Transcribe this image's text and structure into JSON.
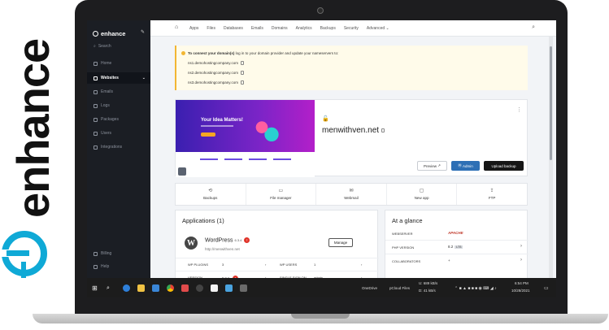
{
  "brand": {
    "wordmark": "enhance",
    "color": "#0fa9d6"
  },
  "sidebar": {
    "logo": "enhance",
    "search": "Search",
    "items": [
      {
        "label": "Home",
        "icon": "home-icon"
      },
      {
        "label": "Websites",
        "icon": "globe-icon",
        "active": true
      },
      {
        "label": "Emails",
        "icon": "mail-icon"
      },
      {
        "label": "Logs",
        "icon": "list-icon"
      },
      {
        "label": "Packages",
        "icon": "package-icon"
      },
      {
        "label": "Users",
        "icon": "users-icon"
      },
      {
        "label": "Integrations",
        "icon": "plug-icon"
      },
      {
        "label": "Billing",
        "icon": "card-icon"
      },
      {
        "label": "Help",
        "icon": "help-icon"
      }
    ]
  },
  "topnav": {
    "links": [
      "Apps",
      "Files",
      "Databases",
      "Emails",
      "Domains",
      "Analytics",
      "Backups",
      "Security",
      "Advanced"
    ]
  },
  "notice": {
    "bold": "To connect your domain(s)",
    "text": " log in to your domain provider and update your nameservers to:",
    "nameservers": [
      "ns1.demohostingcompany.com",
      "ns2.demohostingcompany.com",
      "ns3.demohostingcompany.com"
    ]
  },
  "site": {
    "domain": "menwithven.net",
    "preview_hero_title": "Your Idea Matters!",
    "btn_preview": "Preview",
    "btn_admin": "Admin",
    "btn_upload": "Upload backup"
  },
  "actions": [
    {
      "label": "Backups",
      "icon": "clock-icon",
      "glyph": "⟲"
    },
    {
      "label": "File manager",
      "icon": "folder-icon",
      "glyph": "▭"
    },
    {
      "label": "Webmail",
      "icon": "mail-icon",
      "glyph": "✉"
    },
    {
      "label": "New app",
      "icon": "app-icon",
      "glyph": "▢"
    },
    {
      "label": "FTP",
      "icon": "upload-icon",
      "glyph": "⇪"
    }
  ],
  "applications": {
    "title": "Applications (1)",
    "app_name": "WordPress",
    "app_version": "6.3.4",
    "app_badge": "!",
    "app_url": "http://menwithven.net",
    "manage": "Manage",
    "rows": [
      {
        "k1": "WP PLUGINS",
        "v1": "3",
        "k2": "WP USERS",
        "v2": "1"
      },
      {
        "k1": "VERSION",
        "v1": "6.3.4",
        "k2": "SINGLE SIGN ON",
        "v2": "admin"
      }
    ]
  },
  "glance": {
    "title": "At a glance",
    "rows": [
      {
        "key": "WEBSERVER",
        "val": "APACHE"
      },
      {
        "key": "PHP VERSION",
        "val": "8.2",
        "badge": "LTS"
      },
      {
        "key": "COLLABORATORS",
        "val": "+"
      }
    ]
  },
  "taskbar": {
    "onedrive": "OneDrive",
    "pcloud": "pCloud Files",
    "up": "U:",
    "up_val": "689 kB/s",
    "down": "D:",
    "down_val": "41 kB/s",
    "time": "6:54 PM",
    "date": "10/28/2021"
  }
}
